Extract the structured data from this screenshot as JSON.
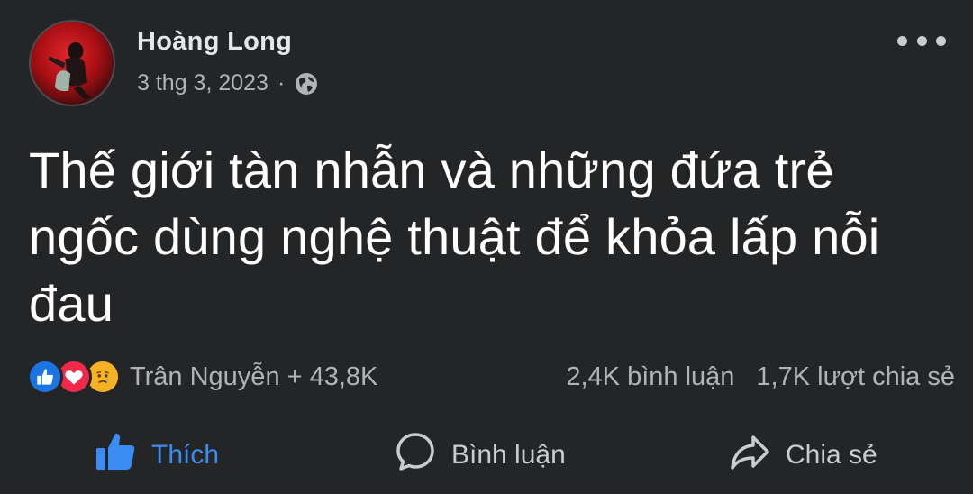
{
  "post": {
    "author": "Hoàng Long",
    "date": "3 thg 3, 2023",
    "separator": "·",
    "privacy_icon": "globe-icon",
    "text": "Thế giới tàn nhẫn và những đứa trẻ ngốc dùng nghệ thuật để khỏa lấp nỗi đau"
  },
  "stats": {
    "reaction_icons": [
      "like-icon",
      "love-icon",
      "sad-icon"
    ],
    "reaction_summary": "Trân Nguyễn + 43,8K",
    "comments": "2,4K bình luận",
    "shares": "1,7K lượt chia sẻ"
  },
  "actions": {
    "like_label": "Thích",
    "comment_label": "Bình luận",
    "share_label": "Chia sẻ"
  },
  "colors": {
    "background": "#242526",
    "like_blue": "#3b8cf3",
    "text_secondary": "#b0b3b8",
    "love_red": "#f02849",
    "sad_yellow": "#f7b125"
  }
}
